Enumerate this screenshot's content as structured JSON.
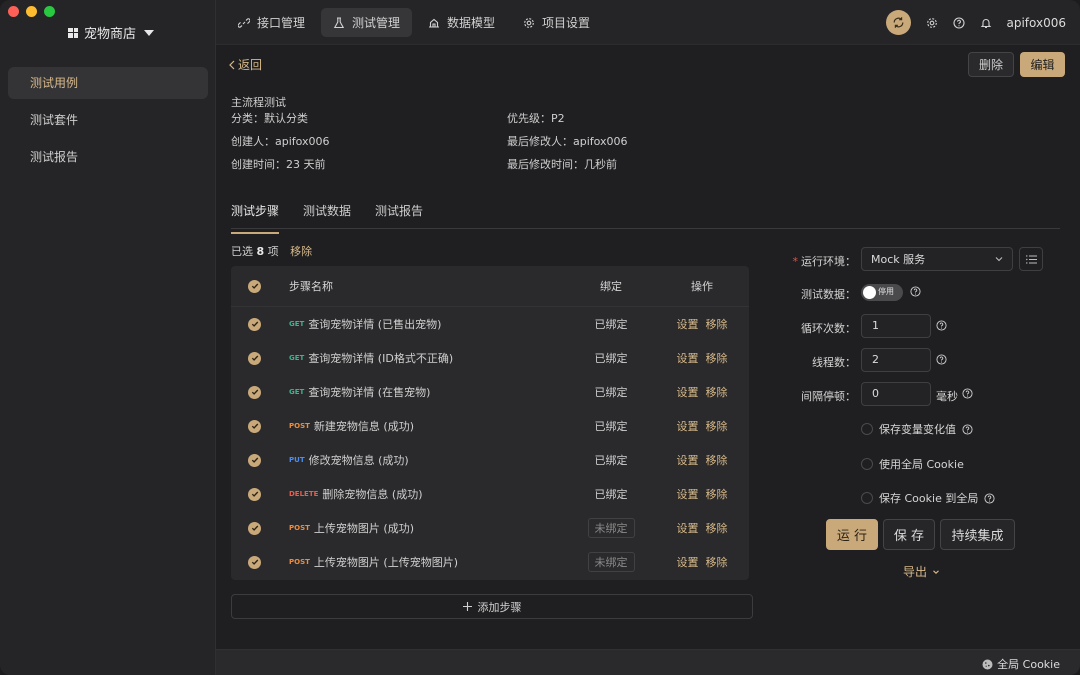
{
  "sidebar": {
    "project_name": "宠物商店",
    "items": [
      {
        "label": "测试用例",
        "active": true
      },
      {
        "label": "测试套件",
        "active": false
      },
      {
        "label": "测试报告",
        "active": false
      }
    ]
  },
  "topbar": {
    "tabs": [
      {
        "label": "接口管理",
        "icon": "link-icon"
      },
      {
        "label": "测试管理",
        "icon": "flask-icon",
        "active": true
      },
      {
        "label": "数据模型",
        "icon": "model-icon"
      },
      {
        "label": "项目设置",
        "icon": "gear-icon"
      }
    ],
    "username": "apifox006"
  },
  "header": {
    "back_label": "返回",
    "delete_label": "删除",
    "edit_label": "编辑"
  },
  "meta": {
    "title": "主流程测试",
    "category": "分类：默认分类",
    "priority": "优先级：P2",
    "creator": "创建人：apifox006",
    "modifier": "最后修改人：apifox006",
    "created": "创建时间：23 天前",
    "modified": "最后修改时间：几秒前"
  },
  "subtabs": [
    {
      "label": "测试步骤",
      "active": true
    },
    {
      "label": "测试数据"
    },
    {
      "label": "测试报告"
    }
  ],
  "selection": {
    "prefix": "已选",
    "count": "8",
    "suffix": "项",
    "remove_label": "移除"
  },
  "table": {
    "headers": {
      "name": "步骤名称",
      "bind": "绑定",
      "op": "操作"
    },
    "rows": [
      {
        "method": "GET",
        "name": "查询宠物详情 (已售出宠物)",
        "bind": "已绑定",
        "bound": true
      },
      {
        "method": "GET",
        "name": "查询宠物详情 (ID格式不正确)",
        "bind": "已绑定",
        "bound": true
      },
      {
        "method": "GET",
        "name": "查询宠物详情 (在售宠物)",
        "bind": "已绑定",
        "bound": true
      },
      {
        "method": "POST",
        "name": "新建宠物信息 (成功)",
        "bind": "已绑定",
        "bound": true
      },
      {
        "method": "PUT",
        "name": "修改宠物信息 (成功)",
        "bind": "已绑定",
        "bound": true
      },
      {
        "method": "DELETE",
        "name": "删除宠物信息 (成功)",
        "bind": "已绑定",
        "bound": true
      },
      {
        "method": "POST",
        "name": "上传宠物图片 (成功)",
        "bind": "未绑定",
        "bound": false
      },
      {
        "method": "POST",
        "name": "上传宠物图片 (上传宠物图片)",
        "bind": "未绑定",
        "bound": false
      }
    ],
    "op_settings": "设置",
    "op_remove": "移除",
    "add_step": "添加步骤"
  },
  "form": {
    "env_label": "运行环境",
    "env_value": "Mock 服务",
    "data_label": "测试数据",
    "data_toggle": "停用",
    "loop_label": "循环次数",
    "loop_value": "1",
    "thread_label": "线程数",
    "thread_value": "2",
    "interval_label": "间隔停顿",
    "interval_value": "0",
    "interval_unit": "毫秒",
    "cb_save_var": "保存变量变化值",
    "cb_global_cookie": "使用全局 Cookie",
    "cb_save_cookie": "保存 Cookie 到全局",
    "run": "运 行",
    "save": "保 存",
    "ci": "持续集成",
    "export": "导出"
  },
  "footer": {
    "cookie": "全局 Cookie"
  },
  "colors": {
    "accent": "#c9a97a",
    "get": "#3ab58c",
    "post": "#f08c3a",
    "put": "#4a8ef5",
    "delete": "#ef5b4b"
  }
}
